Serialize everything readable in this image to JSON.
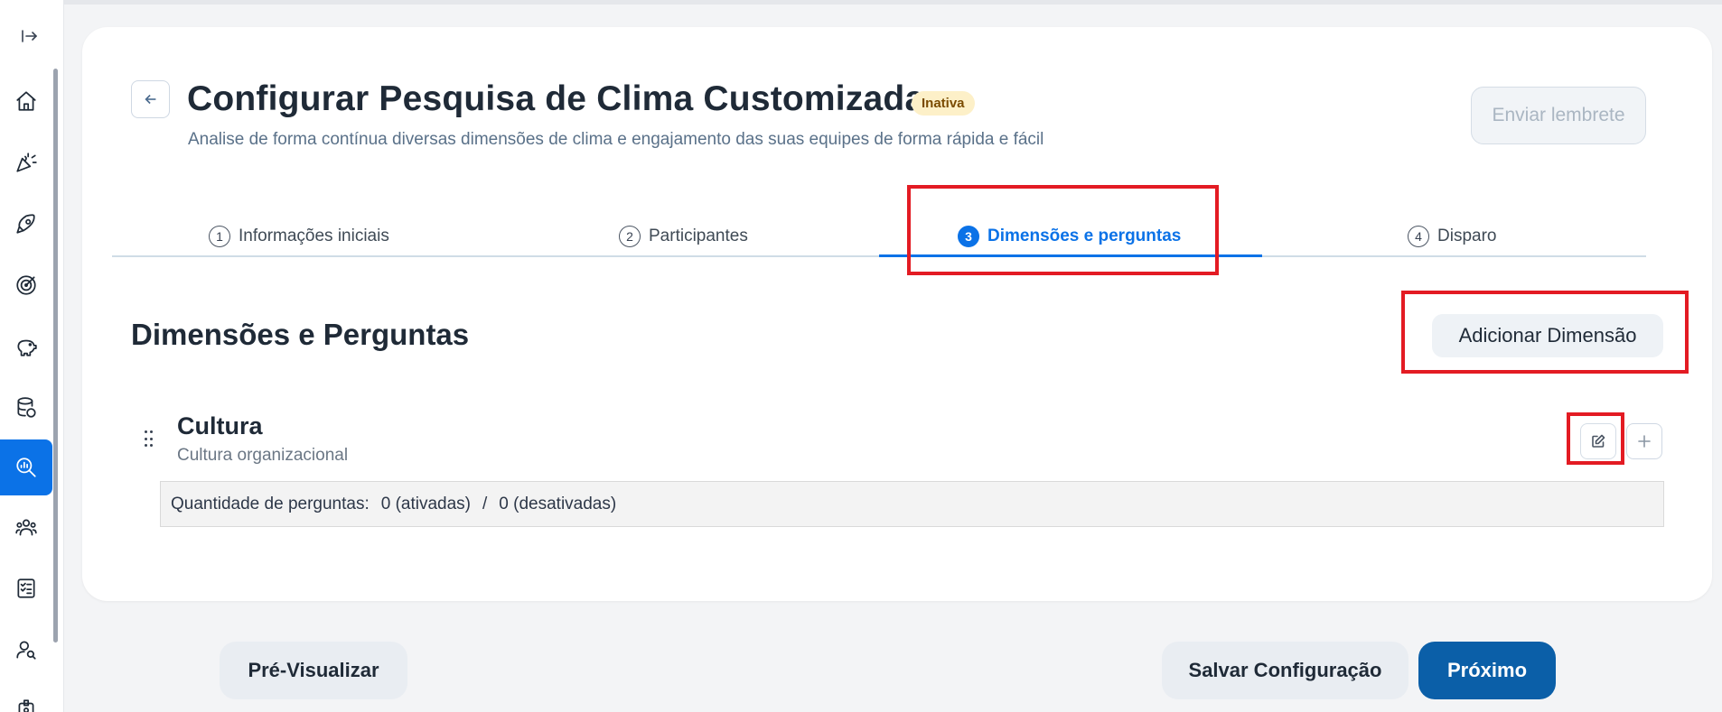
{
  "page": {
    "title": "Configurar Pesquisa de Clima Customizada",
    "status": "Inativa",
    "subtitle": "Analise de forma contínua diversas dimensões de clima e engajamento das suas equipes de forma rápida e fácil",
    "reminder_label": "Enviar lembrete"
  },
  "steps": [
    {
      "num": "1",
      "label": "Informações iniciais"
    },
    {
      "num": "2",
      "label": "Participantes"
    },
    {
      "num": "3",
      "label": "Dimensões e perguntas"
    },
    {
      "num": "4",
      "label": "Disparo"
    }
  ],
  "section": {
    "title": "Dimensões e Perguntas",
    "add_label": "Adicionar Dimensão"
  },
  "dimension": {
    "name": "Cultura",
    "description": "Cultura organizacional",
    "qty_label": "Quantidade de perguntas:",
    "qty_active": "0 (ativadas)",
    "qty_sep": "/",
    "qty_inactive": "0 (desativadas)"
  },
  "footer": {
    "preview_label": "Pré-Visualizar",
    "save_label": "Salvar Configuração",
    "next_label": "Próximo"
  },
  "colors": {
    "accent": "#0b72e7",
    "primary_button": "#0b5fa8",
    "highlight": "#e31b23",
    "badge_bg": "#fdf0c8"
  },
  "sidebar_icons": [
    "expand-icon",
    "home-icon",
    "celebration-icon",
    "rocket-icon",
    "target-icon",
    "piggy-bank-icon",
    "database-icon",
    "search-chart-icon",
    "team-icon",
    "checklist-icon",
    "user-search-icon",
    "badge-icon"
  ]
}
